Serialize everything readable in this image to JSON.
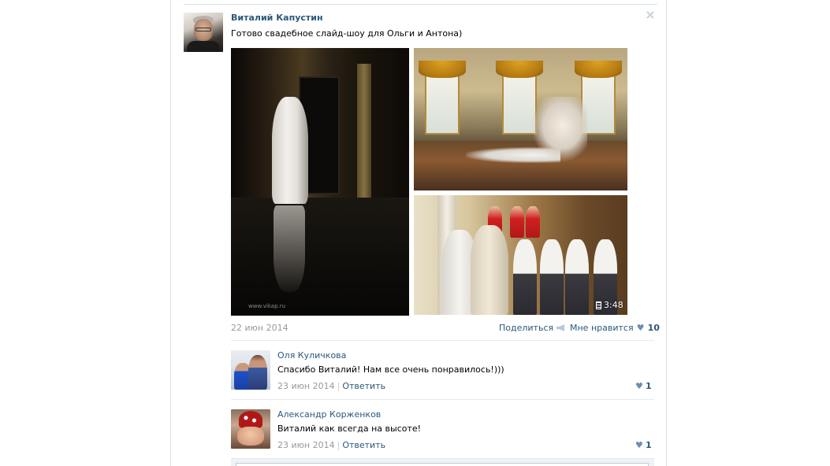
{
  "post": {
    "author_name": "Виталий Капустин",
    "text": "Готово свадебное слайд-шоу для Ольги и Антона)",
    "close_icon": "close-icon",
    "photo_watermark": "www.vikap.ru",
    "video_duration": "3:48",
    "date": "22 июн 2014",
    "share_label": "Поделиться",
    "like_label": "Мне нравится",
    "like_count": "10"
  },
  "comments": [
    {
      "author": "Оля Куличкова",
      "text": "Спасибо Виталий! Нам все очень понравилось!)))",
      "date": "23 июн 2014",
      "reply_label": "Ответить",
      "likes": "1"
    },
    {
      "author": "Александр Корженков",
      "text": "Виталий как всегда на высоте!",
      "date": "23 июн 2014",
      "reply_label": "Ответить",
      "likes": "1"
    }
  ],
  "colors": {
    "link": "#2b587a",
    "muted": "#999999",
    "divider": "#e7eaed",
    "heart": "#6b8fb4"
  }
}
